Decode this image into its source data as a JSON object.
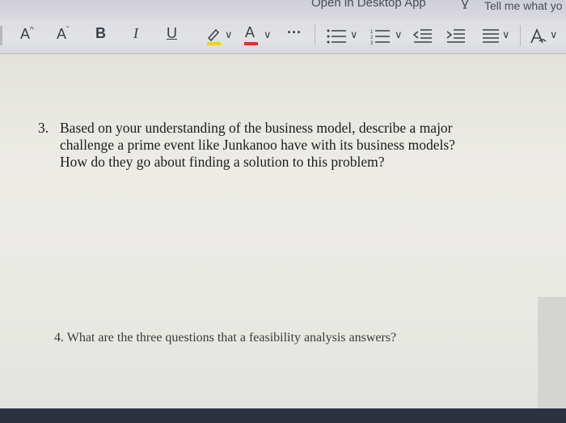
{
  "topbar": {
    "open_desktop_app": "Open in Desktop App",
    "tell_me": "Tell me what yo"
  },
  "ribbon": {
    "grow_font": "A",
    "shrink_font": "A",
    "bold": "B",
    "italic": "I",
    "underline": "U",
    "font_color": "A",
    "more": "···",
    "chevron": "∨",
    "highlight_color": "#f2d024",
    "font_color_bar": "#d9342b"
  },
  "document": {
    "q3": {
      "number": "3.",
      "lines": [
        "Based on your understanding of the business model, describe a major",
        "challenge a prime event like Junkanoo have with its business models?",
        "How do they go about finding a solution to this problem?"
      ]
    },
    "q4": "4.  What are the three questions that a feasibility analysis answers?"
  }
}
